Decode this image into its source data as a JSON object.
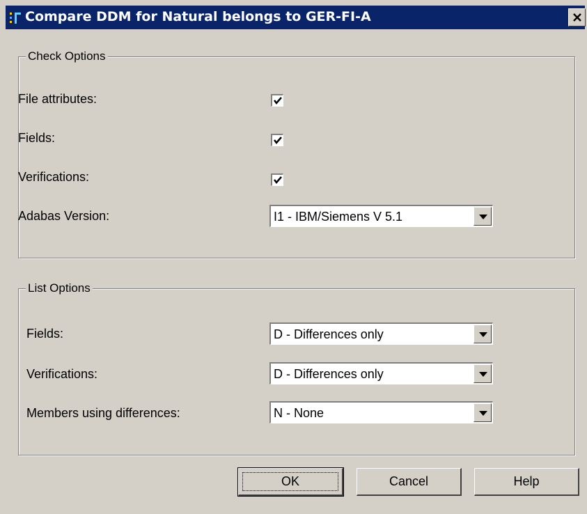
{
  "dialog": {
    "title": "Compare DDM for Natural belongs to GER-FI-A"
  },
  "check_options": {
    "legend": "Check Options",
    "file_attributes_label": "File attributes:",
    "file_attributes_checked": true,
    "fields_label": "Fields:",
    "fields_checked": true,
    "verifications_label": "Verifications:",
    "verifications_checked": true,
    "adabas_version_label": "Adabas Version:",
    "adabas_version_value": "I1 - IBM/Siemens V 5.1"
  },
  "list_options": {
    "legend": "List Options",
    "fields_label": "Fields:",
    "fields_value": "D - Differences only",
    "verifications_label": "Verifications:",
    "verifications_value": "D - Differences only",
    "members_label": "Members using differences:",
    "members_value": "N - None"
  },
  "buttons": {
    "ok": "OK",
    "cancel": "Cancel",
    "help": "Help"
  },
  "icons": {
    "app": "application-icon",
    "close": "close-icon",
    "check": "checkmark-icon",
    "dropdown": "chevron-down-icon"
  }
}
